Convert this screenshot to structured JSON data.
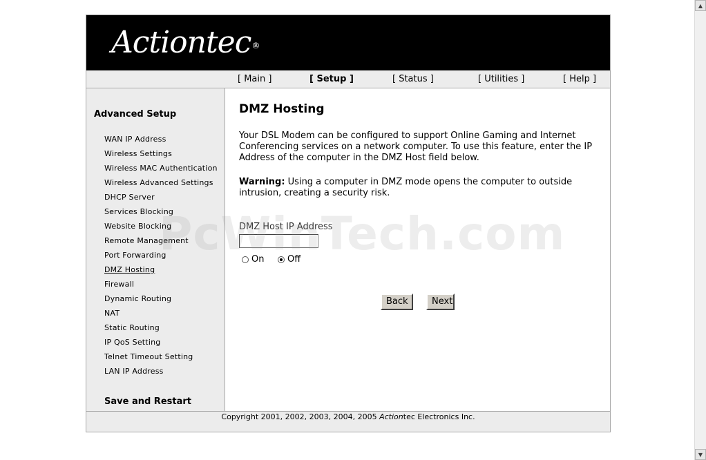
{
  "brand": {
    "logo_text": "Actiontec",
    "logo_reg": "®"
  },
  "nav": {
    "items": [
      {
        "label": "[ Main ]",
        "active": false
      },
      {
        "label": "[ Setup ]",
        "active": true
      },
      {
        "label": "[ Status ]",
        "active": false
      },
      {
        "label": "[ Utilities ]",
        "active": false
      },
      {
        "label": "[ Help ]",
        "active": false
      }
    ]
  },
  "sidebar": {
    "heading": "Advanced Setup",
    "items": [
      {
        "label": "WAN IP Address"
      },
      {
        "label": "Wireless Settings"
      },
      {
        "label": "Wireless MAC Authentication"
      },
      {
        "label": "Wireless Advanced Settings"
      },
      {
        "label": "DHCP Server"
      },
      {
        "label": "Services Blocking"
      },
      {
        "label": "Website Blocking"
      },
      {
        "label": "Remote Management"
      },
      {
        "label": "Port Forwarding"
      },
      {
        "label": "DMZ Hosting",
        "current": true
      },
      {
        "label": "Firewall"
      },
      {
        "label": "Dynamic Routing"
      },
      {
        "label": "NAT"
      },
      {
        "label": "Static Routing"
      },
      {
        "label": "IP QoS Setting"
      },
      {
        "label": "Telnet Timeout Setting"
      },
      {
        "label": "LAN IP Address"
      }
    ],
    "save_label": "Save and Restart"
  },
  "main": {
    "title": "DMZ Hosting",
    "intro": "Your DSL Modem can be configured to support Online Gaming and Internet Conferencing services on a network computer. To use this feature, enter the IP Address of the computer in the DMZ Host field below.",
    "warning_label": "Warning:",
    "warning_text": " Using a computer in DMZ mode opens the computer to outside intrusion, creating a security risk.",
    "field_label": "DMZ Host IP Address",
    "field_value": "",
    "radio_on": "On",
    "radio_off": "Off",
    "radio_selected": "Off",
    "back_label": "Back",
    "next_label": "Next"
  },
  "footer": {
    "copyright_prefix": "Copyright 2001, 2002, 2003, 2004, 2005 ",
    "copyright_brand": "Action",
    "copyright_suffix": "tec Electronics Inc."
  },
  "watermark": "PcWinTech.com"
}
